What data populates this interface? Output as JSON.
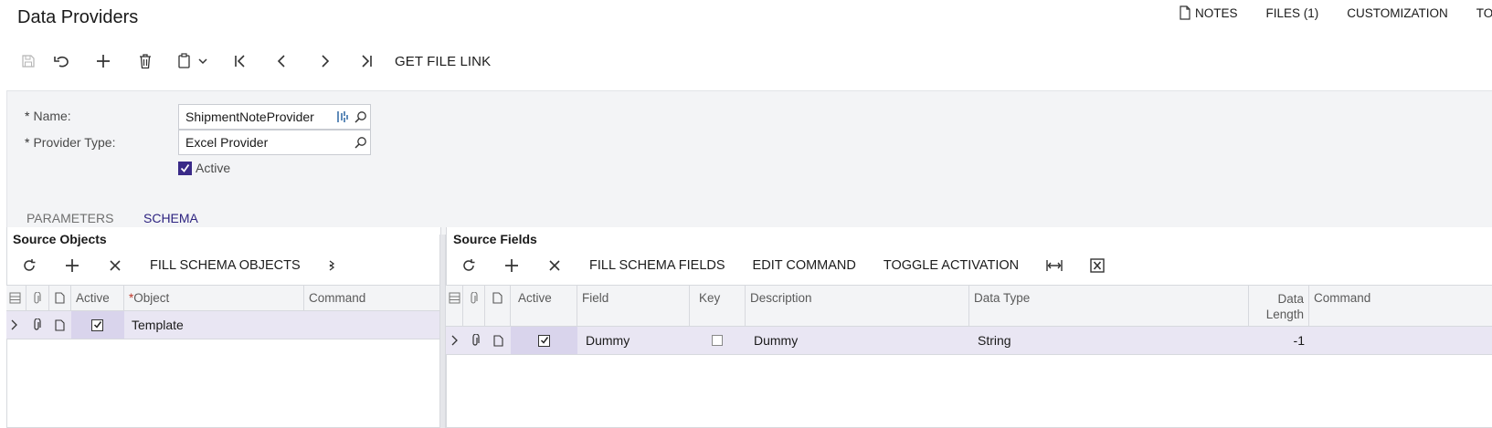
{
  "page": {
    "title": "Data Providers"
  },
  "top_links": [
    {
      "label": "NOTES",
      "icon": "note-icon"
    },
    {
      "label": "FILES (1)"
    },
    {
      "label": "CUSTOMIZATION"
    },
    {
      "label": "TO"
    }
  ],
  "toolbar": {
    "buttons": [
      "save-icon",
      "undo-icon",
      "add-icon",
      "delete-icon",
      "copy-paste-icon",
      "first-icon",
      "previous-icon",
      "next-icon",
      "last-icon"
    ],
    "get_file_link": "GET FILE LINK"
  },
  "form": {
    "name_label": "Name:",
    "name_value": "ShipmentNoteProvider",
    "provider_type_label": "Provider Type:",
    "provider_type_value": "Excel Provider",
    "active_label": "Active",
    "active_checked": true,
    "required_mark": "*"
  },
  "tabs": [
    {
      "label": "PARAMETERS",
      "active": false
    },
    {
      "label": "SCHEMA",
      "active": true
    }
  ],
  "source_objects": {
    "title": "Source Objects",
    "toolbar": {
      "fill": "FILL SCHEMA OBJECTS"
    },
    "columns": {
      "active": "Active",
      "object_req": "*",
      "object": "Object",
      "command": "Command"
    },
    "rows": [
      {
        "active": true,
        "object": "Template",
        "command": ""
      }
    ]
  },
  "source_fields": {
    "title": "Source Fields",
    "toolbar": {
      "fill": "FILL SCHEMA FIELDS",
      "edit": "EDIT COMMAND",
      "toggle": "TOGGLE ACTIVATION"
    },
    "columns": {
      "active": "Active",
      "field": "Field",
      "key": "Key",
      "description": "Description",
      "data_type": "Data Type",
      "data_length_1": "Data",
      "data_length_2": "Length",
      "command": "Command"
    },
    "rows": [
      {
        "active": true,
        "field": "Dummy",
        "key": false,
        "description": "Dummy",
        "data_type": "String",
        "data_length": "-1",
        "command": ""
      }
    ]
  },
  "colors": {
    "accent": "#2d2380",
    "panel": "#f3f4f6",
    "row_selected": "#e9e6f3",
    "checkbox": "#3a2a88"
  }
}
